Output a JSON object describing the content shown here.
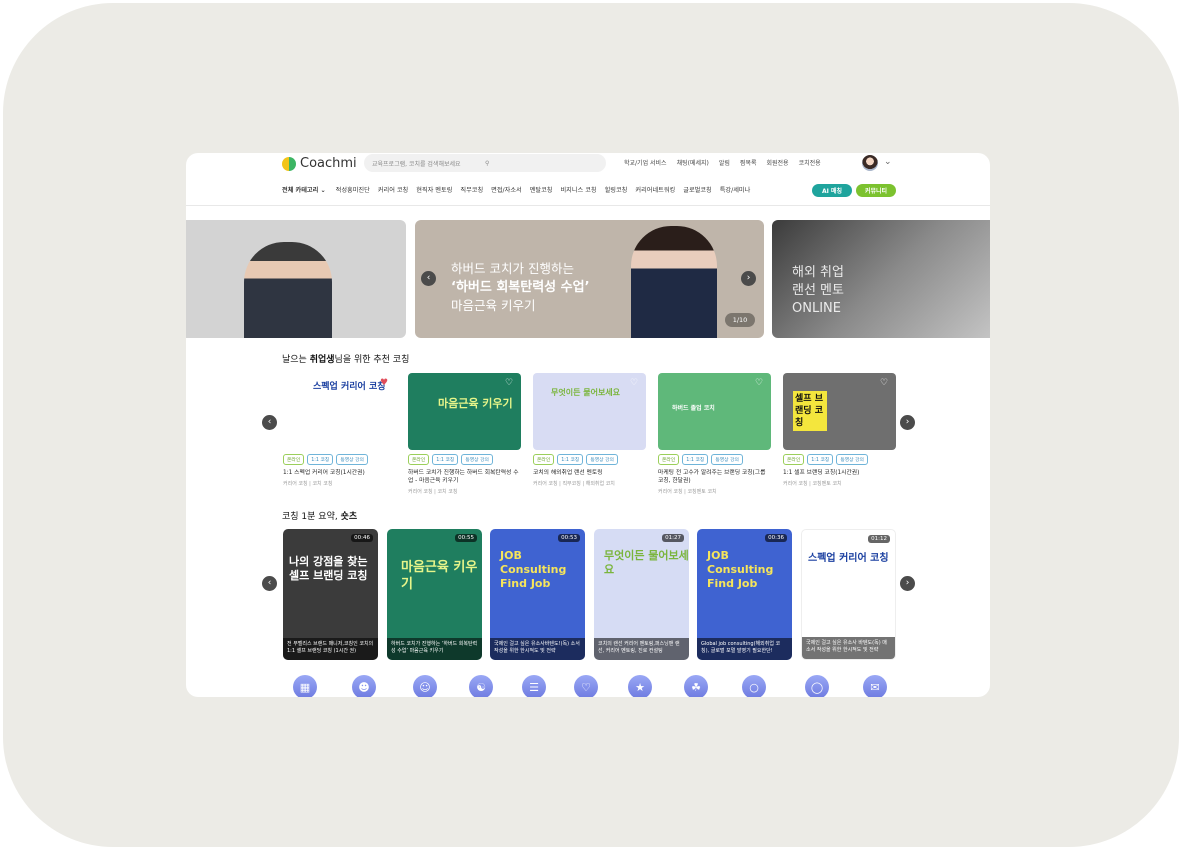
{
  "header": {
    "logo": "Coachmi",
    "search_placeholder": "교육프로그램, 코치를 검색해보세요",
    "top_links": [
      "학교/기업 서비스",
      "채팅(메세지)",
      "알림",
      "찜목록",
      "회원전용",
      "코치전용"
    ]
  },
  "nav": {
    "all": "전체 카테고리",
    "items": [
      "적성흥미진단",
      "커리어 코칭",
      "현직자 멘토링",
      "직무코칭",
      "면접/자소서",
      "멘탈코칭",
      "비지니스 코칭",
      "힐링코칭",
      "커리어네트워킹",
      "글로벌코칭",
      "특강/세미나"
    ],
    "ai_button": "AI 매칭",
    "community_button": "커뮤니티"
  },
  "banner": {
    "line1": "하버드 코치가 진행하는",
    "line2": "‘하버드 회복탄력성 수업’",
    "line3": "마음근육 키우기",
    "side_line1": "해외 취업",
    "side_line2": "랜선 멘토",
    "side_line3": "ONLINE",
    "counter": "1/10"
  },
  "section1": {
    "pre": "날으는 ",
    "bold": "취업생",
    "post": "님을 위한 추천 코칭"
  },
  "cards": [
    {
      "thumb": "스펙업 커리어 코칭",
      "tags": [
        "온라인",
        "1:1 코칭",
        "동영상 강의"
      ],
      "title": "1:1 스펙업 커리어 코칭(1시간권)",
      "meta": "커리어 코칭 | 코치 코칭"
    },
    {
      "thumb": "마음근육 키우기",
      "tags": [
        "온라인",
        "1:1 코칭",
        "동영상 강의"
      ],
      "title": "하버드 코치가 진행하는 하버드 회복탄력성 수업 - 마음근육 키우기",
      "meta": "커리어 코칭 | 코치 코칭"
    },
    {
      "thumb": "무엇이든 물어보세요",
      "tags": [
        "온라인",
        "1:1 코칭",
        "동영상 강의"
      ],
      "title": "코치의 해외취업 랜선 멘토링",
      "meta": "커리어 코칭 | 직무코칭 | 해외취업 코치"
    },
    {
      "thumb": "하버드 졸업 코치",
      "tags": [
        "온라인",
        "1:1 코칭",
        "동영상 강의"
      ],
      "title": "마케팅 전 고수가 알려주는 브랜딩 코칭(그룹 코칭, 한달권)",
      "meta": "커리어 코칭 | 코칭멘토 코치"
    },
    {
      "thumb": "셀프 브랜딩 코칭",
      "tags": [
        "온라인",
        "1:1 코칭",
        "동영상 강의"
      ],
      "title": "1:1 셀프 브랜딩 코칭(1시간권)",
      "meta": "커리어 코칭 | 코칭멘토 코치"
    }
  ],
  "section2": {
    "pre": "코칭 1분 요약, ",
    "bold": "숏츠"
  },
  "videos": [
    {
      "dur": "00:46",
      "text": "나의 강점을 찾는 셀프 브랜딩 코칭",
      "cap": "전 부벨리스 브랜드 매니저,코칭인 코치의 1:1 셀프 브랜딩 코칭 (1시간 권)"
    },
    {
      "dur": "00:55",
      "text": "마음근육 키우기",
      "cap": "하버드 코치가 진행하는 ‘하버드 회복탄력성 수업’ 마음근육 키우기"
    },
    {
      "dur": "00:53",
      "text": "JOB Consulting Find Job",
      "cap": "국제인 걸고 싶은 유소사바텐도!(독) 소서 작성을 위한 한시적도 및 전략"
    },
    {
      "dur": "01:27",
      "text": "무엇이든 물어보세요",
      "cap": "코치의 랜선 커리어 멘토링,퍼스닝맨 랜선, 커리어 멘토링, 진로 컨설팅"
    },
    {
      "dur": "00:36",
      "text": "JOB Consulting Find Job",
      "cap": "Global job consulting(해외취업 코칭), 글로벌 포멀 발영기 필요한단!"
    },
    {
      "dur": "01:12",
      "text": "스펙업 커리어 코칭",
      "cap": "국제인 걸고 싶은 유소사 바텐도(독) 매 소서 작성을 위한 한시적도 및 전략"
    }
  ],
  "colors": {
    "ai": "#1fa49d",
    "community": "#7cc22f",
    "frame": "#ecebe6"
  }
}
